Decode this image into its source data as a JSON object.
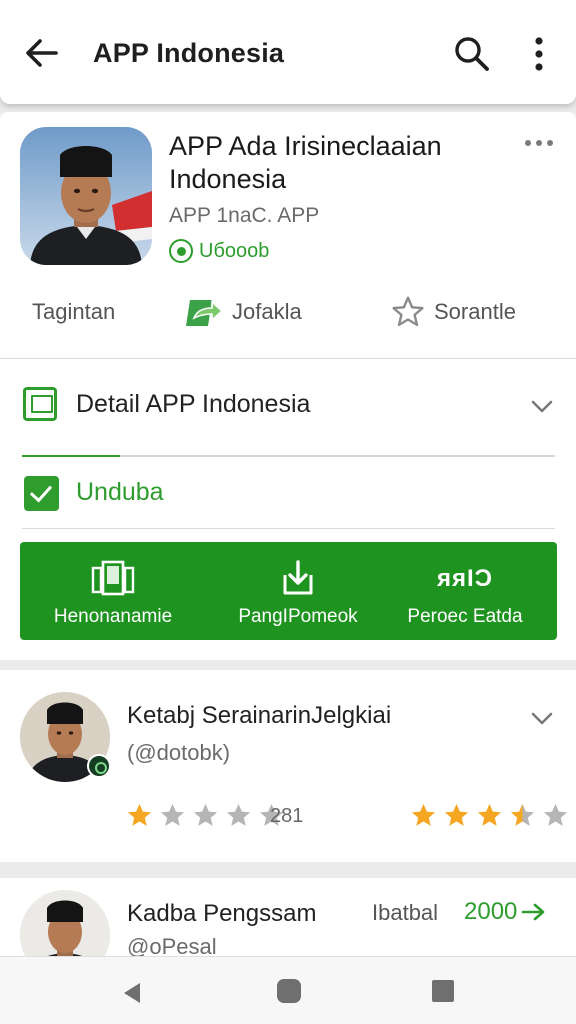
{
  "toolbar": {
    "title": "APP Indonesia",
    "back_icon": "arrow-left-icon",
    "search_icon": "search-icon",
    "menu_icon": "more-vert-icon"
  },
  "app": {
    "title": "APP Ada Irisineclaaian Indonesia",
    "subtitle": "APP 1naC. APP",
    "badge": "Uбooob",
    "more_icon": "more-horiz-icon"
  },
  "actions": [
    {
      "label": "Tagintan",
      "icon": "none"
    },
    {
      "label": "Jofakla",
      "icon": "share-arrow-icon"
    },
    {
      "label": "Sorantle",
      "icon": "star-outline-icon"
    }
  ],
  "detail": {
    "label": "Detail APP Indonesia"
  },
  "checkbox": {
    "label": "Unduba",
    "checked": true
  },
  "banner": {
    "items": [
      {
        "label": "Henonanamie",
        "icon": "panels-icon"
      },
      {
        "label": "PangIPomeok",
        "icon": "download-icon"
      },
      {
        "label": "Peroec Eatda",
        "icon": "text-icon",
        "icon_text": "яяƖƆ"
      }
    ]
  },
  "review1": {
    "name": "Ketabj SerainarinJelgkiai",
    "handle": "(@dotobk)",
    "rating_left": 1,
    "count": "281",
    "rating_right": 3.5
  },
  "review2": {
    "name": "Kadba Pengssam",
    "handle": "@oPesal",
    "label": "Ibatbal",
    "value": "2000"
  },
  "colors": {
    "accent": "#2e9d2e",
    "banner": "#1f9320",
    "star": "#f5a623",
    "star_empty": "#b5b5b5"
  }
}
